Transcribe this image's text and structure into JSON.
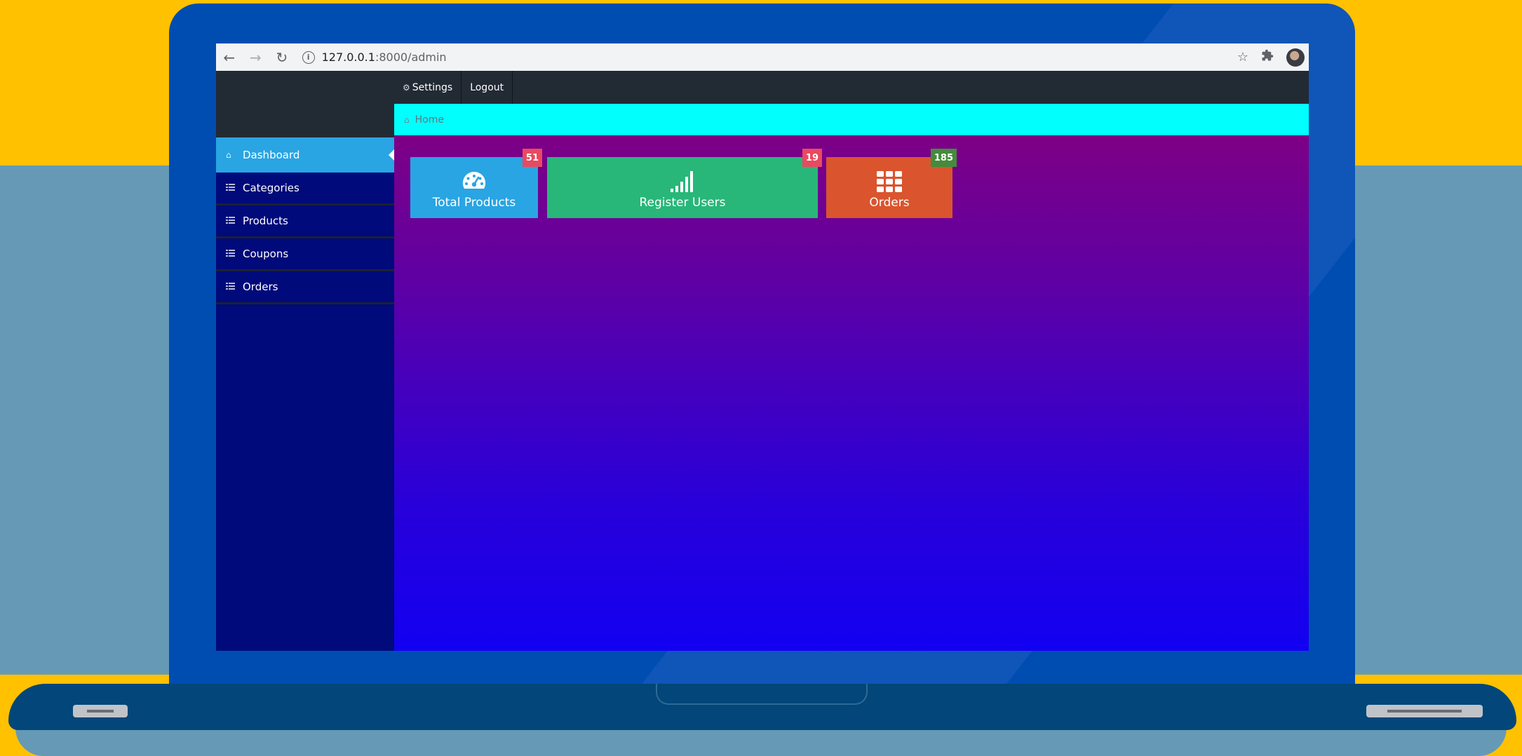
{
  "browser": {
    "url_host": "127.0.0.1",
    "url_path": ":8000/admin",
    "icons": [
      "back-arrow-icon",
      "forward-arrow-icon",
      "reload-icon",
      "info-icon",
      "star-icon",
      "extension-icon",
      "profile-avatar"
    ]
  },
  "topbar": {
    "settings_label": "Settings",
    "logout_label": "Logout"
  },
  "breadcrumb": {
    "home_label": "Home"
  },
  "sidebar": {
    "items": [
      {
        "label": "Dashboard",
        "icon": "home-icon",
        "active": true
      },
      {
        "label": "Categories",
        "icon": "list-icon",
        "active": false
      },
      {
        "label": "Products",
        "icon": "list-icon",
        "active": false
      },
      {
        "label": "Coupons",
        "icon": "list-icon",
        "active": false
      },
      {
        "label": "Orders",
        "icon": "list-icon",
        "active": false
      }
    ]
  },
  "stats": {
    "total_products": {
      "label": "Total Products",
      "count": "51",
      "icon": "dashboard-gauge-icon",
      "color": "#29a5e3",
      "badge_color": "#e84a5f"
    },
    "register_users": {
      "label": "Register Users",
      "count": "19",
      "icon": "signal-bars-icon",
      "color": "#28b779",
      "badge_color": "#e84a5f"
    },
    "orders": {
      "label": "Orders",
      "count": "185",
      "icon": "grid-icon",
      "color": "#da542e",
      "badge_color": "#458b3c"
    }
  },
  "colors": {
    "breadcrumb_bg": "#00fffd",
    "sidebar_bg": "#000a7a",
    "active_item": "#29a5e3",
    "topbar_bg": "#222a33"
  }
}
